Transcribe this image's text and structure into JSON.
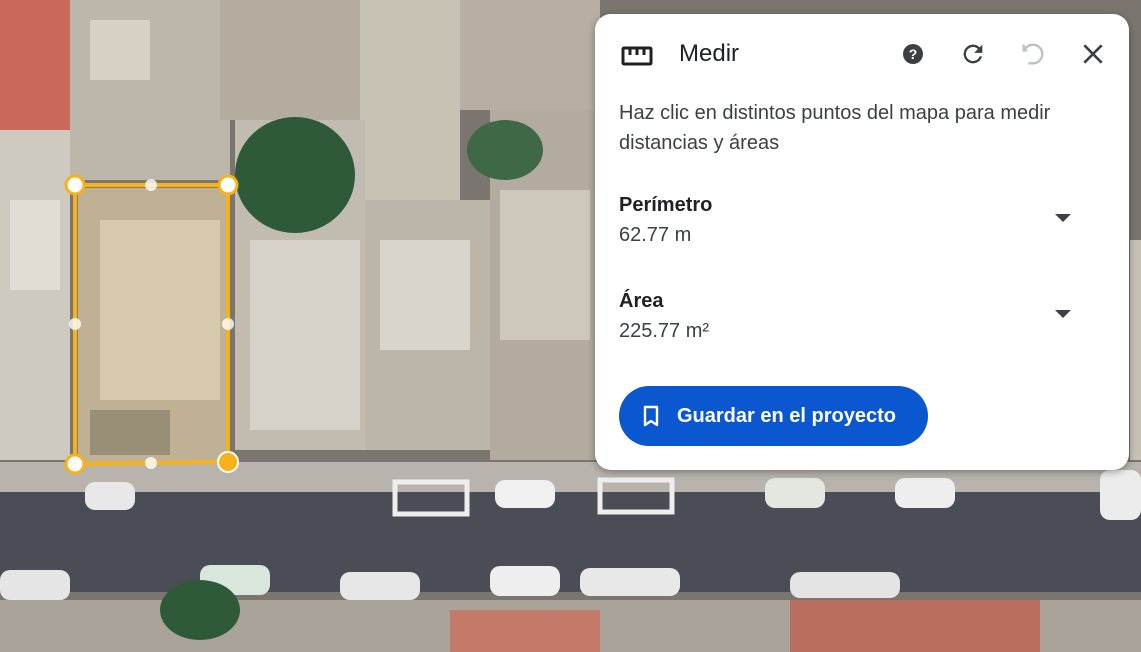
{
  "map": {
    "description_icon": "satellite-imagery"
  },
  "panel": {
    "title": "Medir",
    "icons": {
      "ruler": "ruler-icon",
      "help": "help-icon",
      "redo": "refresh-icon",
      "undo": "undo-icon",
      "close": "close-icon"
    },
    "instructions": "Haz clic en distintos puntos del mapa para medir distancias y áreas",
    "perimeter": {
      "label": "Perímetro",
      "value": "62.77 m"
    },
    "area": {
      "label": "Área",
      "value": "225.77 m²"
    },
    "save_label": "Guardar en el proyecto"
  },
  "colors": {
    "accent": "#0b57d0",
    "polygon": "#f6b21b",
    "panel_bg": "#ffffff"
  }
}
